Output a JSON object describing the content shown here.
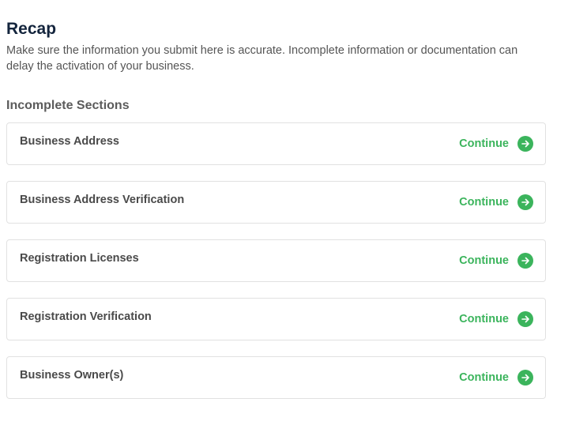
{
  "recap": {
    "title": "Recap",
    "description": "Make sure the information you submit here is accurate. Incomplete information or documentation can delay the activation of your business."
  },
  "incomplete": {
    "heading": "Incomplete Sections",
    "sections": [
      {
        "label": "Business Address",
        "action": "Continue",
        "icon": "arrow-right-circle-icon"
      },
      {
        "label": "Business Address Verification",
        "action": "Continue",
        "icon": "arrow-right-circle-icon"
      },
      {
        "label": "Registration Licenses",
        "action": "Continue",
        "icon": "arrow-right-circle-icon"
      },
      {
        "label": "Registration Verification",
        "action": "Continue",
        "icon": "arrow-right-circle-icon"
      },
      {
        "label": "Business Owner(s)",
        "action": "Continue",
        "icon": "arrow-right-circle-icon"
      }
    ]
  },
  "colors": {
    "accent": "#3bb45c",
    "title": "#14253d",
    "border": "#e1e1e1"
  }
}
